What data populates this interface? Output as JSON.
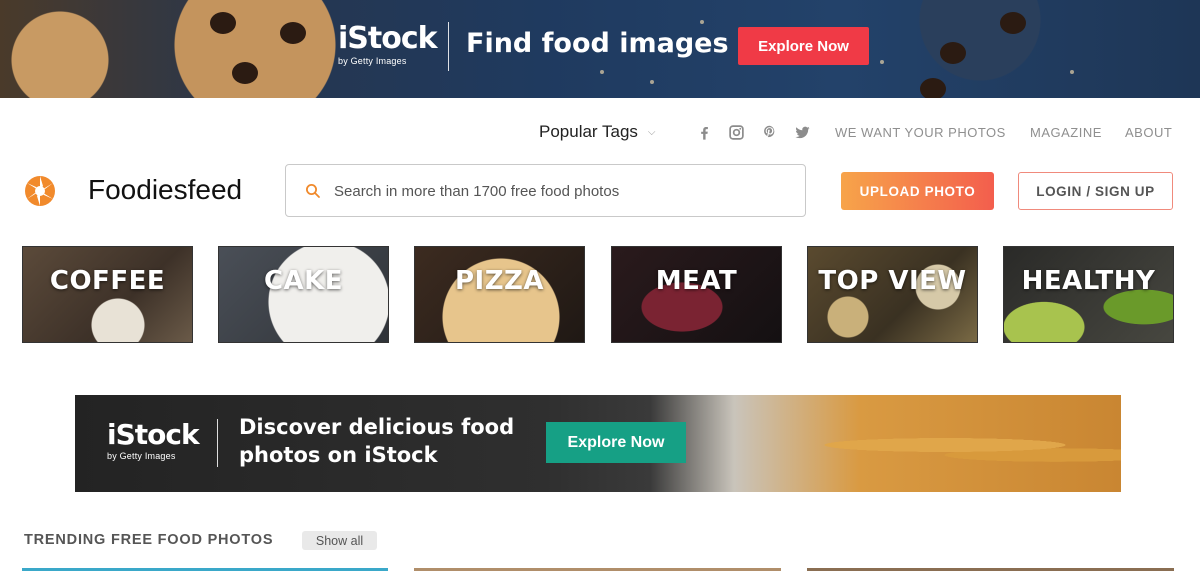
{
  "top_banner": {
    "logo": "iStock",
    "logo_sub": "by Getty Images",
    "headline": "Find food images",
    "cta": "Explore Now"
  },
  "subnav": {
    "popular_tags": "Popular Tags",
    "social_icons": [
      "facebook-icon",
      "instagram-icon",
      "pinterest-icon",
      "twitter-icon"
    ],
    "links": [
      "WE WANT YOUR PHOTOS",
      "MAGAZINE",
      "ABOUT"
    ]
  },
  "header": {
    "site_name": "Foodiesfeed",
    "search_placeholder": "Search in more than 1700 free food photos",
    "search_value": "",
    "upload_label": "UPLOAD PHOTO",
    "login_label": "LOGIN / SIGN UP"
  },
  "categories": [
    "COFFEE",
    "CAKE",
    "PIZZA",
    "MEAT",
    "TOP VIEW",
    "HEALTHY"
  ],
  "mid_banner": {
    "logo": "iStock",
    "logo_sub": "by Getty Images",
    "headline_line1": "Discover delicious food",
    "headline_line2": "photos on iStock",
    "cta": "Explore Now"
  },
  "trending": {
    "title": "TRENDING FREE FOOD PHOTOS",
    "show_all": "Show all"
  },
  "colors": {
    "accent_red": "#f03a46",
    "upload_gradient_start": "#f7a44a",
    "upload_gradient_end": "#f35e4d",
    "istock_green": "#16a085"
  }
}
